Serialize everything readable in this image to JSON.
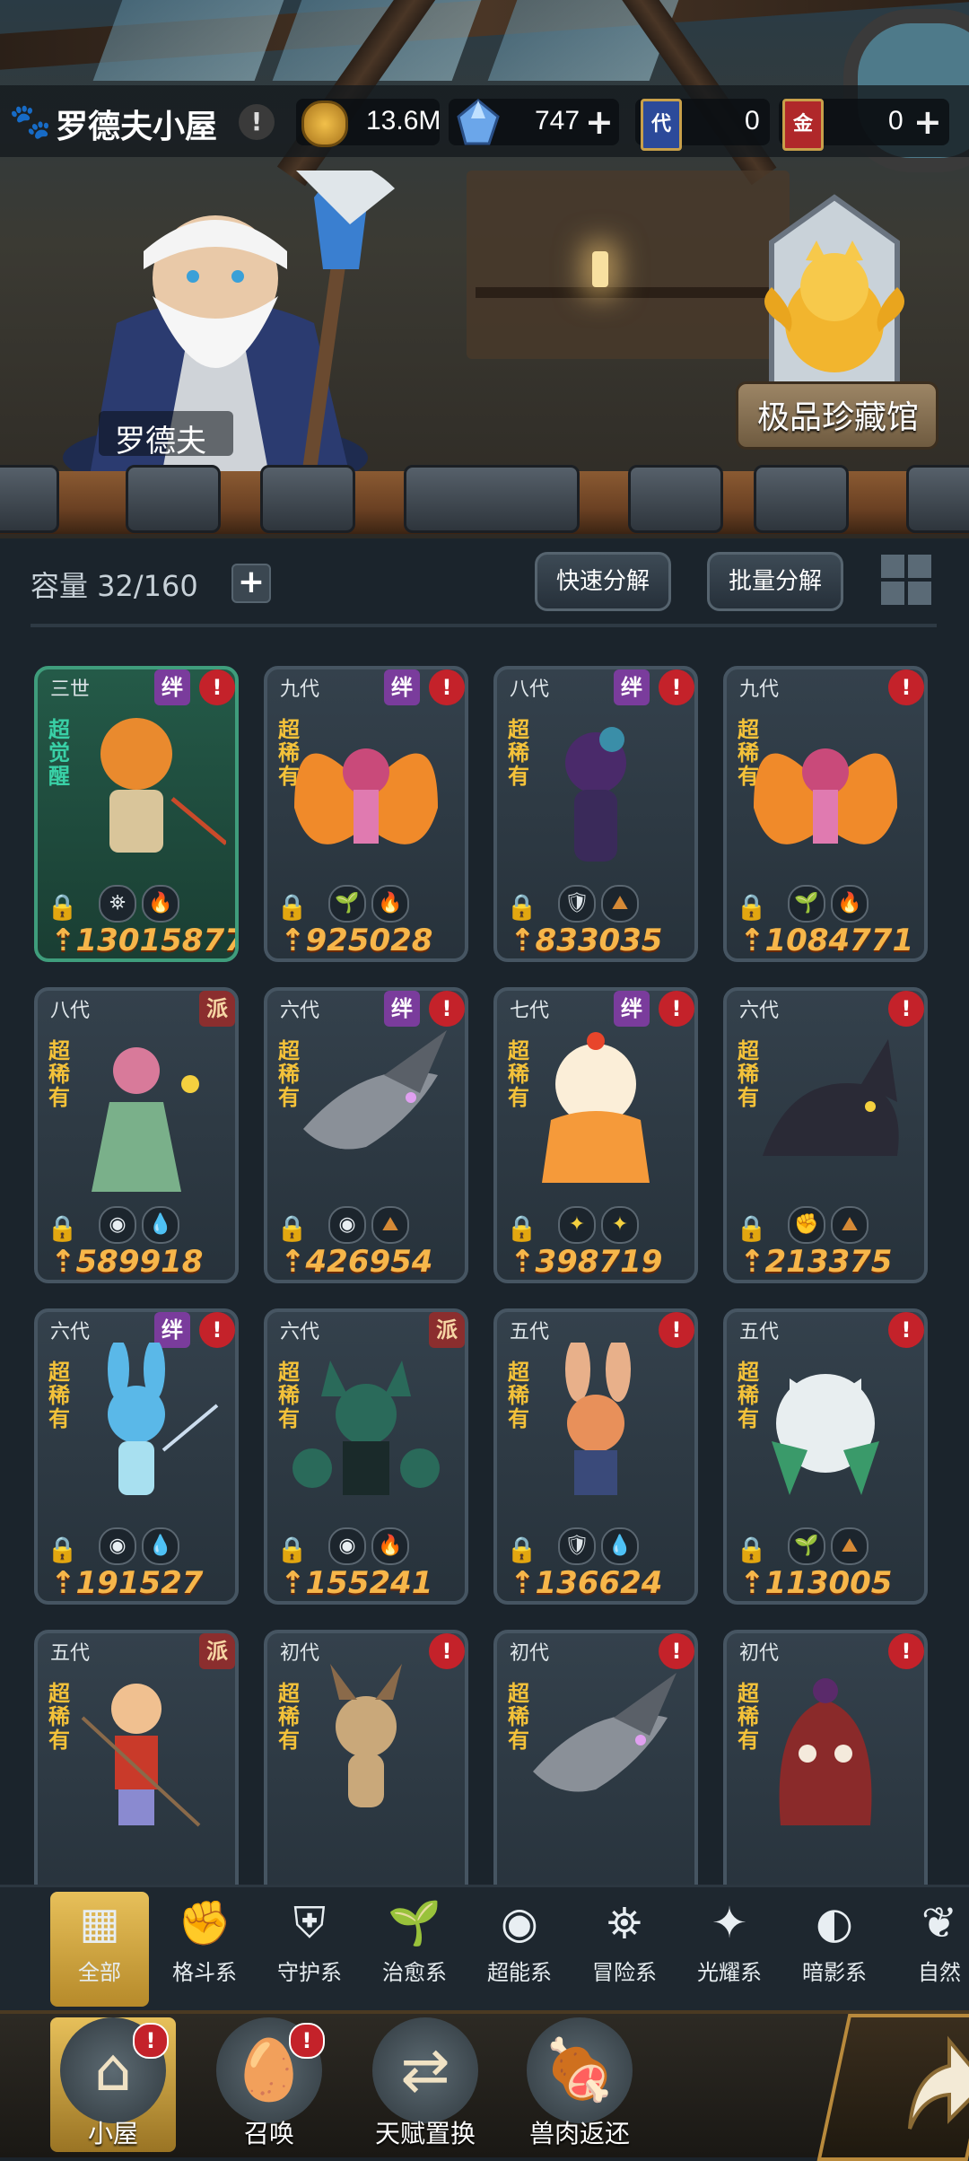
{
  "header": {
    "home_title": "罗德夫小屋",
    "resources": [
      {
        "name": "gold",
        "icon": "gold-coin-icon",
        "value": "13.6M"
      },
      {
        "name": "crystal",
        "icon": "blue-crystal-icon",
        "value": "747"
      },
      {
        "name": "dai_card",
        "icon": "dai-card-icon",
        "icon_text": "代",
        "value": "0"
      },
      {
        "name": "jin_card",
        "icon": "jin-card-icon",
        "icon_text": "金",
        "value": "0"
      }
    ]
  },
  "scene": {
    "npc_name": "罗德夫",
    "collection_label": "极品珍藏馆"
  },
  "capacity": {
    "label": "容量 32/160",
    "quick_decompose": "快速分解",
    "batch_decompose": "批量分解"
  },
  "cards": [
    {
      "gen": "三世",
      "rarity": "超觉醒",
      "badges": [
        "绊",
        "!"
      ],
      "elements": [
        "adventure",
        "fire"
      ],
      "power": "13015877",
      "special": true,
      "character": "orange-cat-warrior"
    },
    {
      "gen": "九代",
      "rarity": "超稀有",
      "badges": [
        "绊",
        "!"
      ],
      "elements": [
        "heal",
        "fire"
      ],
      "power": "925028",
      "special": false,
      "character": "flame-butterfly-fairy"
    },
    {
      "gen": "八代",
      "rarity": "超稀有",
      "badges": [
        "绊",
        "!"
      ],
      "elements": [
        "guard",
        "earth"
      ],
      "power": "833035",
      "special": false,
      "character": "purple-rose-girl"
    },
    {
      "gen": "九代",
      "rarity": "超稀有",
      "badges": [
        "!"
      ],
      "elements": [
        "heal",
        "fire"
      ],
      "power": "1084771",
      "special": false,
      "character": "flame-butterfly-fairy"
    },
    {
      "gen": "八代",
      "rarity": "超稀有",
      "badges": [
        "派"
      ],
      "elements": [
        "psychic",
        "water"
      ],
      "power": "589918",
      "special": false,
      "character": "opera-lady"
    },
    {
      "gen": "六代",
      "rarity": "超稀有",
      "badges": [
        "绊",
        "!"
      ],
      "elements": [
        "psychic",
        "earth"
      ],
      "power": "426954",
      "special": false,
      "character": "grey-dragon"
    },
    {
      "gen": "七代",
      "rarity": "超稀有",
      "badges": [
        "绊",
        "!"
      ],
      "elements": [
        "light",
        "light"
      ],
      "power": "398719",
      "special": false,
      "character": "cream-pudding"
    },
    {
      "gen": "六代",
      "rarity": "超稀有",
      "badges": [
        "!"
      ],
      "elements": [
        "fight",
        "earth"
      ],
      "power": "213375",
      "special": false,
      "character": "black-wolf"
    },
    {
      "gen": "六代",
      "rarity": "超稀有",
      "badges": [
        "绊",
        "!"
      ],
      "elements": [
        "psychic",
        "water"
      ],
      "power": "191527",
      "special": false,
      "character": "blue-rabbit"
    },
    {
      "gen": "六代",
      "rarity": "超稀有",
      "badges": [
        "派"
      ],
      "elements": [
        "psychic",
        "fire"
      ],
      "power": "155241",
      "special": false,
      "character": "green-fox-girl"
    },
    {
      "gen": "五代",
      "rarity": "超稀有",
      "badges": [
        "!"
      ],
      "elements": [
        "guard",
        "water"
      ],
      "power": "136624",
      "special": false,
      "character": "bunny-girl"
    },
    {
      "gen": "五代",
      "rarity": "超稀有",
      "badges": [
        "!"
      ],
      "elements": [
        "heal",
        "earth"
      ],
      "power": "113005",
      "special": false,
      "character": "white-owl"
    },
    {
      "gen": "五代",
      "rarity": "超稀有",
      "badges": [
        "派"
      ],
      "elements": [],
      "power": "",
      "special": false,
      "character": "nezha-boy"
    },
    {
      "gen": "初代",
      "rarity": "超稀有",
      "badges": [
        "!"
      ],
      "elements": [],
      "power": "",
      "special": false,
      "character": "small-dragon"
    },
    {
      "gen": "初代",
      "rarity": "超稀有",
      "badges": [
        "!"
      ],
      "elements": [],
      "power": "",
      "special": false,
      "character": "grey-dragon"
    },
    {
      "gen": "初代",
      "rarity": "超稀有",
      "badges": [
        "!"
      ],
      "elements": [],
      "power": "",
      "special": false,
      "character": "chocolate-pudding"
    }
  ],
  "filters": [
    {
      "label": "全部",
      "icon": "grid-icon",
      "active": true
    },
    {
      "label": "格斗系",
      "icon": "fist-icon",
      "active": false
    },
    {
      "label": "守护系",
      "icon": "shield-icon",
      "active": false
    },
    {
      "label": "治愈系",
      "icon": "sprout-icon",
      "active": false
    },
    {
      "label": "超能系",
      "icon": "alien-icon",
      "active": false
    },
    {
      "label": "冒险系",
      "icon": "lantern-icon",
      "active": false
    },
    {
      "label": "光耀系",
      "icon": "star-compass-icon",
      "active": false
    },
    {
      "label": "暗影系",
      "icon": "moon-eye-icon",
      "active": false
    },
    {
      "label": "自然",
      "icon": "leaf-icon",
      "active": false
    }
  ],
  "bottom_nav": [
    {
      "label": "小屋",
      "icon": "house-icon",
      "active": true,
      "alert": true
    },
    {
      "label": "召唤",
      "icon": "egg-icon",
      "active": false,
      "alert": true
    },
    {
      "label": "天赋置换",
      "icon": "swap-arrows-icon",
      "active": false,
      "alert": false
    },
    {
      "label": "兽肉返还",
      "icon": "meat-icon",
      "active": false,
      "alert": false
    }
  ],
  "colors": {
    "power_text": "#f6b64a",
    "rarity_text": "#f4c23a",
    "awaken_text": "#39d0a6",
    "warn_badge": "#c4222a",
    "bond_badge": "#7a3c9c",
    "sect_badge": "#8b2e2e",
    "filter_active": "#e7c05a"
  }
}
